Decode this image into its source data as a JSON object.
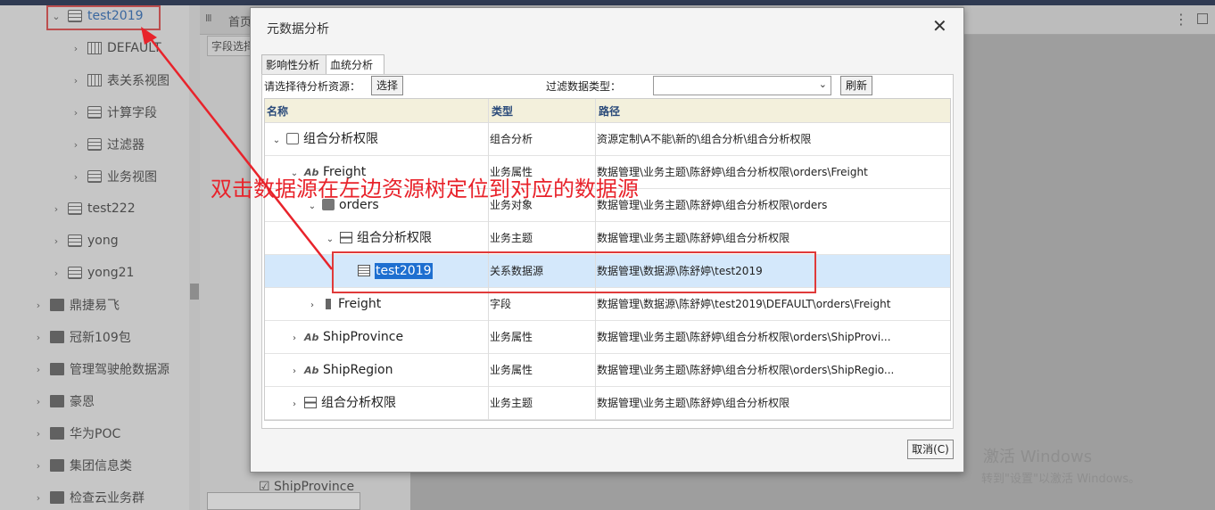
{
  "tree": {
    "items": [
      {
        "label": "test2019",
        "chev": "⌄",
        "icon": "database-table-icon"
      },
      {
        "label": "DEFAULT",
        "chev": "›",
        "icon": "schema-icon"
      },
      {
        "label": "表关系视图",
        "chev": "›",
        "icon": "relation-view-icon"
      },
      {
        "label": "计算字段",
        "chev": "›",
        "icon": "calc-field-icon"
      },
      {
        "label": "过滤器",
        "chev": "›",
        "icon": "filter-icon"
      },
      {
        "label": "业务视图",
        "chev": "›",
        "icon": "search-icon"
      },
      {
        "label": "test222",
        "chev": "›",
        "icon": "database-table-icon"
      },
      {
        "label": "yong",
        "chev": "›",
        "icon": "database-table-icon"
      },
      {
        "label": "yong21",
        "chev": "›",
        "icon": "database-table-icon"
      },
      {
        "label": "鼎捷易飞",
        "chev": "›",
        "icon": "folder-icon"
      },
      {
        "label": "冠新109包",
        "chev": "›",
        "icon": "folder-icon"
      },
      {
        "label": "管理驾驶舱数据源",
        "chev": "›",
        "icon": "folder-icon"
      },
      {
        "label": "豪恩",
        "chev": "›",
        "icon": "folder-icon"
      },
      {
        "label": "华为POC",
        "chev": "›",
        "icon": "folder-icon"
      },
      {
        "label": "集团信息类",
        "chev": "›",
        "icon": "folder-icon"
      },
      {
        "label": "检查云业务群",
        "chev": "›",
        "icon": "folder-icon"
      }
    ]
  },
  "midpanel": {
    "handle": "Ⅲ",
    "home_tab": "首页",
    "field_tab": "字段选择",
    "bottom_row": "ShipProvince"
  },
  "watermark": {
    "line1": "激活 Windows",
    "line2": "转到\"设置\"以激活 Windows。"
  },
  "dialog": {
    "title": "元数据分析",
    "close": "✕",
    "tabs": [
      "影响性分析",
      "血统分析"
    ],
    "source_label": "请选择待分析资源：",
    "select_button": "选择",
    "filter_label": "过滤数据类型：",
    "filter_value": "",
    "refresh_button": "刷新",
    "columns": [
      "名称",
      "类型",
      "路径"
    ],
    "rows": [
      {
        "name": "组合分析权限",
        "type": "组合分析",
        "path": "资源定制\\A不能\\新的\\组合分析\\组合分析权限",
        "twisty": "⌄",
        "icon": "combo-analysis-icon",
        "indent": 0
      },
      {
        "name": "Freight",
        "type": "业务属性",
        "path": "数据管理\\业务主题\\陈舒婷\\组合分析权限\\orders\\Freight",
        "twisty": "⌄",
        "icon": "attribute-icon",
        "indent": 1
      },
      {
        "name": "orders",
        "type": "业务对象",
        "path": "数据管理\\业务主题\\陈舒婷\\组合分析权限\\orders",
        "twisty": "⌄",
        "icon": "business-object-icon",
        "indent": 2
      },
      {
        "name": "组合分析权限",
        "type": "业务主题",
        "path": "数据管理\\业务主题\\陈舒婷\\组合分析权限",
        "twisty": "⌄",
        "icon": "business-subject-icon",
        "indent": 3
      },
      {
        "name": "test2019",
        "type": "关系数据源",
        "path": "数据管理\\数据源\\陈舒婷\\test2019",
        "twisty": "",
        "icon": "database-table-icon",
        "indent": 4,
        "selected": true
      },
      {
        "name": "Freight",
        "type": "字段",
        "path": "数据管理\\数据源\\陈舒婷\\test2019\\DEFAULT\\orders\\Freight",
        "twisty": "›",
        "icon": "field-icon",
        "indent": 2
      },
      {
        "name": "ShipProvince",
        "type": "业务属性",
        "path": "数据管理\\业务主题\\陈舒婷\\组合分析权限\\orders\\ShipProvi...",
        "twisty": "›",
        "icon": "attribute-icon",
        "indent": 1
      },
      {
        "name": "ShipRegion",
        "type": "业务属性",
        "path": "数据管理\\业务主题\\陈舒婷\\组合分析权限\\orders\\ShipRegio...",
        "twisty": "›",
        "icon": "attribute-icon",
        "indent": 1
      },
      {
        "name": "组合分析权限",
        "type": "业务主题",
        "path": "数据管理\\业务主题\\陈舒婷\\组合分析权限",
        "twisty": "›",
        "icon": "business-subject-icon",
        "indent": 1
      }
    ],
    "cancel_button": "取消(C)"
  },
  "annotation": {
    "text": "双击数据源在左边资源树定位到对应的数据源",
    "color": "#e8232b"
  }
}
